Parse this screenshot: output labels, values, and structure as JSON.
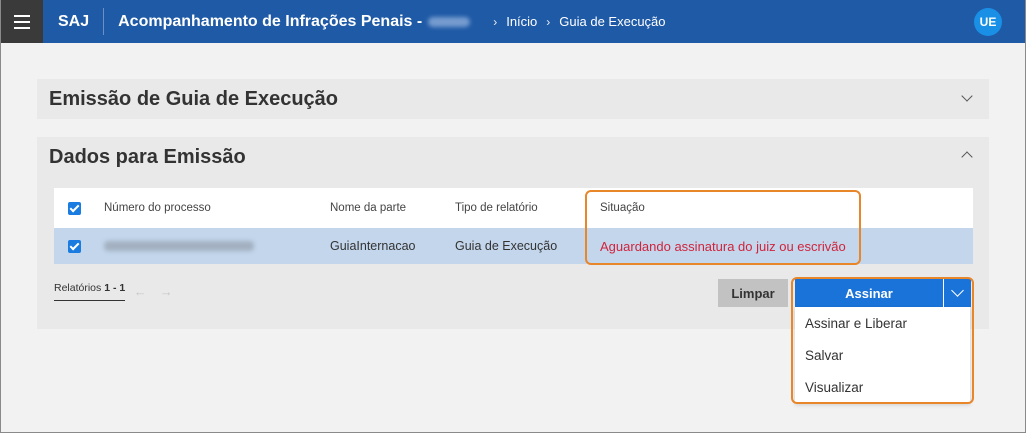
{
  "topbar": {
    "brand": "SAJ",
    "app_title": "Acompanhamento de Infrações Penais -",
    "breadcrumbs": [
      "Início",
      "Guia de Execução"
    ],
    "avatar_initials": "UE",
    "color": "#1f5aa6"
  },
  "panels": {
    "emissao": {
      "title": "Emissão de Guia de Execução",
      "expanded": false
    },
    "dados": {
      "title": "Dados para Emissão",
      "expanded": true
    }
  },
  "table": {
    "columns": [
      "Número do processo",
      "Nome da parte",
      "Tipo de relatório",
      "Situação"
    ],
    "rows": [
      {
        "checked": true,
        "numero_processo": "",
        "nome_parte": "GuiaInternacao",
        "tipo_relatorio": "Guia de Execução",
        "situacao": "Aguardando assinatura do juiz ou escrivão"
      }
    ],
    "status_color": "#d0243c"
  },
  "pager": {
    "label": "Relatórios",
    "range": "1 - 1",
    "prev_icon": "arrow-left-icon",
    "next_icon": "arrow-right-icon"
  },
  "actions": {
    "clear_label": "Limpar",
    "sign_label": "Assinar",
    "sign_menu": [
      "Assinar e Liberar",
      "Salvar",
      "Visualizar"
    ],
    "primary_color": "#1a73d8"
  },
  "highlight_color": "#e8862a"
}
